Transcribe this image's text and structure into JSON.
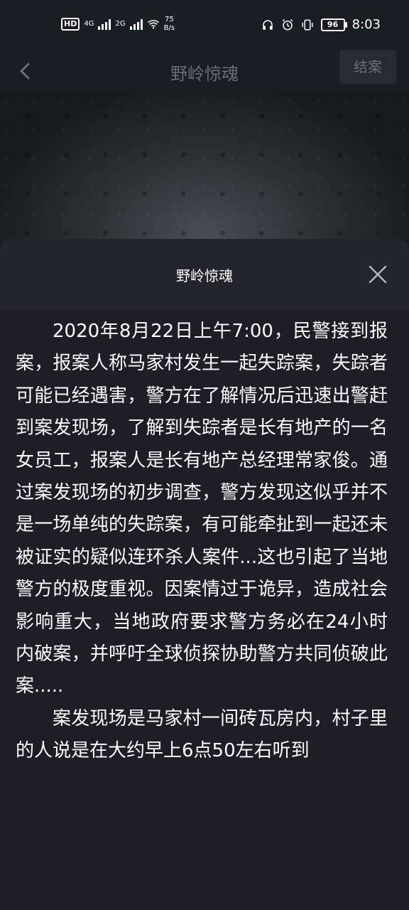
{
  "status_bar": {
    "hd_label": "HD",
    "net1": "4G",
    "net2": "2G",
    "speed_value": "75",
    "speed_unit": "B/s",
    "battery": "96",
    "time": "8:03"
  },
  "nav": {
    "title": "野岭惊魂",
    "close_case_label": "结案"
  },
  "sheet": {
    "title": "野岭惊魂",
    "paragraphs": [
      "2020年8月22日上午7:00，民警接到报案，报案人称马家村发生一起失踪案，失踪者可能已经遇害，警方在了解情况后迅速出警赶到案发现场，了解到失踪者是长有地产的一名女员工，报案人是长有地产总经理常家俊。通过案发现场的初步调查，警方发现这似乎并不是一场单纯的失踪案，有可能牵扯到一起还未被证实的疑似连环杀人案件...这也引起了当地警方的极度重视。因案情过于诡异，造成社会影响重大，当地政府要求警方务必在24小时内破案，并呼吁全球侦探协助警方共同侦破此案.....",
      "案发现场是马家村一间砖瓦房内，村子里的人说是在大约早上6点50左右听到"
    ]
  },
  "icons": {
    "back": "chevron-left-icon",
    "close": "close-icon",
    "wifi": "wifi-icon",
    "headphones": "headphones-icon",
    "alarm": "alarm-icon",
    "vibrate": "vibrate-icon"
  }
}
